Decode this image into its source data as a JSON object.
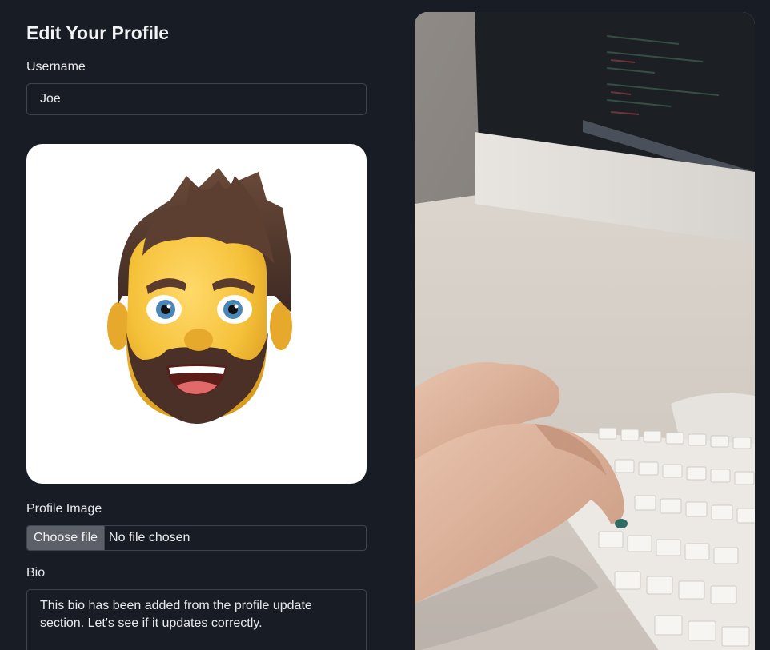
{
  "form": {
    "title": "Edit Your Profile",
    "username_label": "Username",
    "username_value": "Joe",
    "profile_image_label": "Profile Image",
    "choose_file_label": "Choose file",
    "file_status": "No file chosen",
    "bio_label": "Bio",
    "bio_value": "This bio has been added from the profile update section. Let's see if it updates correctly."
  },
  "icons": {
    "avatar": "memoji-avatar-icon",
    "hero": "typing-on-keyboard-photo"
  },
  "colors": {
    "background": "#181d25",
    "input_border": "#3d444e",
    "file_button": "#5b6069",
    "text": "#e8eaed"
  }
}
